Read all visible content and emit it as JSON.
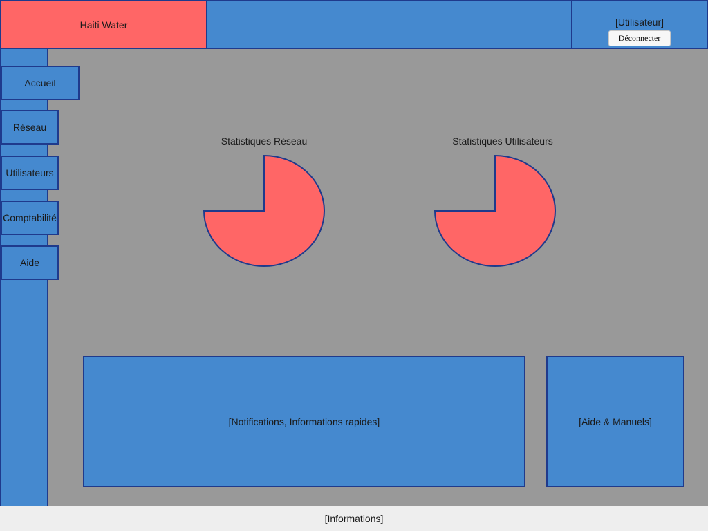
{
  "header": {
    "app_title": "Haiti Water",
    "user_label": "[Utilisateur]",
    "logout_label": "Déconnecter"
  },
  "sidebar": {
    "items": [
      {
        "label": "Accueil"
      },
      {
        "label": "Réseau"
      },
      {
        "label": "Utilisateurs"
      },
      {
        "label": "Comptabilité"
      },
      {
        "label": "Aide"
      }
    ]
  },
  "main": {
    "stats": [
      {
        "title": "Statistiques Réseau"
      },
      {
        "title": "Statistiques Utilisateurs"
      }
    ],
    "notifications_panel": "[Notifications, Informations rapides]",
    "help_panel": "[Aide & Manuels]"
  },
  "footer": {
    "text": "[Informations]"
  },
  "chart_data": [
    {
      "type": "pie",
      "title": "Statistiques Réseau",
      "values": [
        75,
        25
      ],
      "colors": [
        "#ff6666",
        "transparent"
      ]
    },
    {
      "type": "pie",
      "title": "Statistiques Utilisateurs",
      "values": [
        75,
        25
      ],
      "colors": [
        "#ff6666",
        "transparent"
      ]
    }
  ],
  "colors": {
    "accent_blue": "#4589cf",
    "border_navy": "#1f3a8c",
    "brand_red": "#ff6666",
    "background_gray": "#999999",
    "footer_bg": "#eeeeee"
  }
}
